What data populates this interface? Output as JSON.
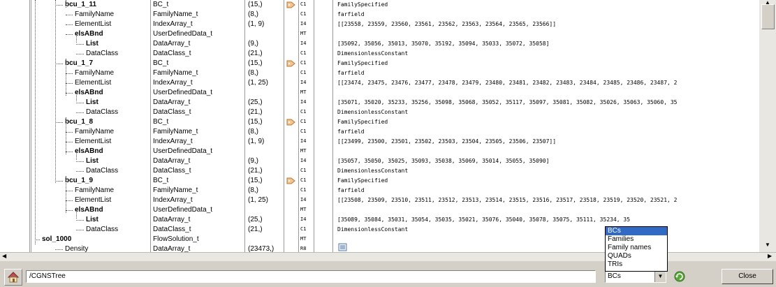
{
  "tree": {
    "rows": [
      {
        "name": "bcu_1_11",
        "bold": true,
        "indent": 1,
        "type": "BC_t",
        "shape": "(15,)",
        "flag": true,
        "dt": "C1",
        "value": "FamilySpecified"
      },
      {
        "name": "FamilyName",
        "bold": false,
        "indent": 2,
        "type": "FamilyName_t",
        "shape": "(8,)",
        "flag": false,
        "dt": "C1",
        "value": "farfield"
      },
      {
        "name": "ElementList",
        "bold": false,
        "indent": 2,
        "type": "IndexArray_t",
        "shape": "(1, 9)",
        "flag": false,
        "dt": "I4",
        "value": "[[23558, 23559, 23560, 23561, 23562, 23563, 23564, 23565, 23566]]"
      },
      {
        "name": "elsABnd",
        "bold": true,
        "indent": 2,
        "type": "UserDefinedData_t",
        "shape": "",
        "flag": false,
        "dt": "MT",
        "value": ""
      },
      {
        "name": "List",
        "bold": true,
        "indent": 3,
        "type": "DataArray_t",
        "shape": "(9,)",
        "flag": false,
        "dt": "I4",
        "value": "[35092, 35056, 35013, 35070, 35192, 35094, 35033, 35072, 35058]"
      },
      {
        "name": "DataClass",
        "bold": false,
        "indent": 3,
        "type": "DataClass_t",
        "shape": "(21,)",
        "flag": false,
        "dt": "C1",
        "value": "DimensionlessConstant"
      },
      {
        "name": "bcu_1_7",
        "bold": true,
        "indent": 1,
        "type": "BC_t",
        "shape": "(15,)",
        "flag": true,
        "dt": "C1",
        "value": "FamilySpecified"
      },
      {
        "name": "FamilyName",
        "bold": false,
        "indent": 2,
        "type": "FamilyName_t",
        "shape": "(8,)",
        "flag": false,
        "dt": "C1",
        "value": "farfield"
      },
      {
        "name": "ElementList",
        "bold": false,
        "indent": 2,
        "type": "IndexArray_t",
        "shape": "(1, 25)",
        "flag": false,
        "dt": "I4",
        "value": "[[23474, 23475, 23476, 23477, 23478, 23479, 23480, 23481, 23482, 23483, 23484, 23485, 23486, 23487, 2"
      },
      {
        "name": "elsABnd",
        "bold": true,
        "indent": 2,
        "type": "UserDefinedData_t",
        "shape": "",
        "flag": false,
        "dt": "MT",
        "value": ""
      },
      {
        "name": "List",
        "bold": true,
        "indent": 3,
        "type": "DataArray_t",
        "shape": "(25,)",
        "flag": false,
        "dt": "I4",
        "value": "[35071, 35020, 35233, 35256, 35098, 35068, 35052, 35117, 35097, 35081, 35082, 35026, 35063, 35060, 35"
      },
      {
        "name": "DataClass",
        "bold": false,
        "indent": 3,
        "type": "DataClass_t",
        "shape": "(21,)",
        "flag": false,
        "dt": "C1",
        "value": "DimensionlessConstant"
      },
      {
        "name": "bcu_1_8",
        "bold": true,
        "indent": 1,
        "type": "BC_t",
        "shape": "(15,)",
        "flag": true,
        "dt": "C1",
        "value": "FamilySpecified"
      },
      {
        "name": "FamilyName",
        "bold": false,
        "indent": 2,
        "type": "FamilyName_t",
        "shape": "(8,)",
        "flag": false,
        "dt": "C1",
        "value": "farfield"
      },
      {
        "name": "ElementList",
        "bold": false,
        "indent": 2,
        "type": "IndexArray_t",
        "shape": "(1, 9)",
        "flag": false,
        "dt": "I4",
        "value": "[[23499, 23500, 23501, 23502, 23503, 23504, 23505, 23506, 23507]]"
      },
      {
        "name": "elsABnd",
        "bold": true,
        "indent": 2,
        "type": "UserDefinedData_t",
        "shape": "",
        "flag": false,
        "dt": "MT",
        "value": ""
      },
      {
        "name": "List",
        "bold": true,
        "indent": 3,
        "type": "DataArray_t",
        "shape": "(9,)",
        "flag": false,
        "dt": "I4",
        "value": "[35057, 35050, 35025, 35093, 35038, 35069, 35014, 35055, 35090]"
      },
      {
        "name": "DataClass",
        "bold": false,
        "indent": 3,
        "type": "DataClass_t",
        "shape": "(21,)",
        "flag": false,
        "dt": "C1",
        "value": "DimensionlessConstant"
      },
      {
        "name": "bcu_1_9",
        "bold": true,
        "indent": 1,
        "type": "BC_t",
        "shape": "(15,)",
        "flag": true,
        "dt": "C1",
        "value": "FamilySpecified"
      },
      {
        "name": "FamilyName",
        "bold": false,
        "indent": 2,
        "type": "FamilyName_t",
        "shape": "(8,)",
        "flag": false,
        "dt": "C1",
        "value": "farfield"
      },
      {
        "name": "ElementList",
        "bold": false,
        "indent": 2,
        "type": "IndexArray_t",
        "shape": "(1, 25)",
        "flag": false,
        "dt": "I4",
        "value": "[[23508, 23509, 23510, 23511, 23512, 23513, 23514, 23515, 23516, 23517, 23518, 23519, 23520, 23521, 2"
      },
      {
        "name": "elsABnd",
        "bold": true,
        "indent": 2,
        "type": "UserDefinedData_t",
        "shape": "",
        "flag": false,
        "dt": "MT",
        "value": ""
      },
      {
        "name": "List",
        "bold": true,
        "indent": 3,
        "type": "DataArray_t",
        "shape": "(25,)",
        "flag": false,
        "dt": "I4",
        "value": "[35089, 35084, 35031, 35054, 35035, 35021, 35076, 35040, 35078,          35075, 35111, 35234, 35"
      },
      {
        "name": "DataClass",
        "bold": false,
        "indent": 3,
        "type": "DataClass_t",
        "shape": "(21,)",
        "flag": false,
        "dt": "C1",
        "value": "DimensionlessConstant"
      },
      {
        "name": "sol_1000",
        "bold": true,
        "indent": 0,
        "type": "FlowSolution_t",
        "shape": "",
        "flag": false,
        "dt": "MT",
        "value": ""
      },
      {
        "name": "Density",
        "bold": false,
        "indent": 1,
        "type": "DataArray_t",
        "shape": "(23473,)",
        "flag": false,
        "dt": "R8",
        "value": ""
      }
    ]
  },
  "bottom": {
    "path": "/CGNSTree",
    "filter_selected": "BCs",
    "filter_options": [
      "BCs",
      "Families",
      "Family names",
      "QUADs",
      "TRIs"
    ],
    "close_label": "Close"
  },
  "icons": {
    "home": "home-icon",
    "refresh": "refresh-icon",
    "flag": "tag-icon",
    "data": "data-view-icon"
  },
  "colors": {
    "selection": "#316ac5",
    "panel": "#d4d0c8"
  }
}
